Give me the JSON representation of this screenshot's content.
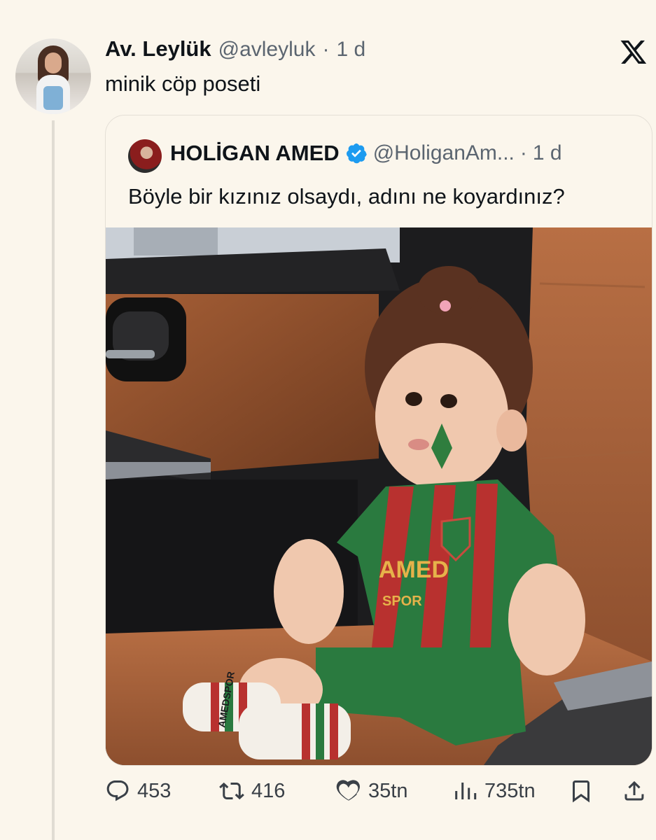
{
  "tweet": {
    "author_name": "Av. Leylük",
    "author_handle": "@avleyluk",
    "separator": "·",
    "time": "1 d",
    "text": "minik cöp poseti"
  },
  "quoted_tweet": {
    "author_name": "HOLİGAN AMED",
    "author_handle": "@HoliganAm...",
    "separator": "·",
    "time": "1 d",
    "text": "Böyle bir kızınız olsaydı, adını ne koyardınız?",
    "image": {
      "jersey_text_main": "AMED",
      "jersey_text_sub": "SPOR",
      "sock_text": "AMEDSPOR"
    }
  },
  "actions": {
    "replies": "453",
    "reposts": "416",
    "likes": "35tn",
    "views": "735tn"
  },
  "icons": [
    "x-logo-icon",
    "verified-badge-icon",
    "reply-icon",
    "repost-icon",
    "like-icon",
    "views-icon",
    "bookmark-icon",
    "share-icon"
  ],
  "colors": {
    "background": "#fbf6ec",
    "verified": "#1d9bf0",
    "muted": "#5b6570"
  }
}
